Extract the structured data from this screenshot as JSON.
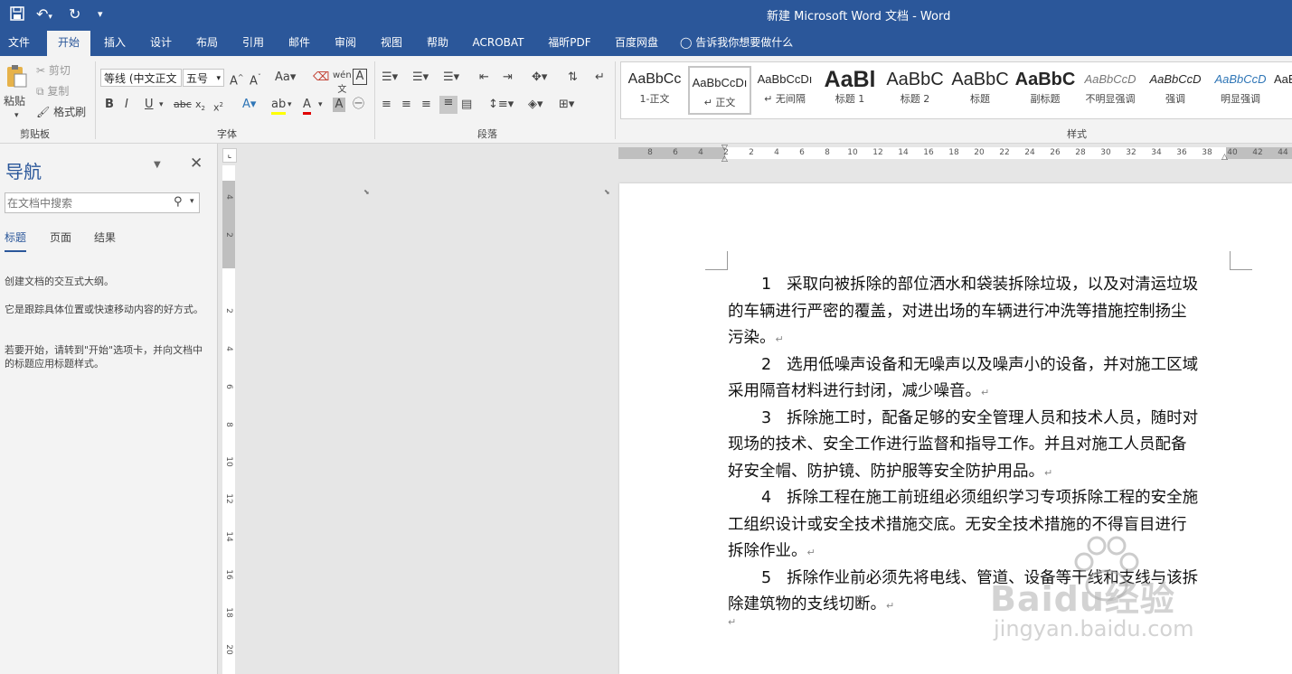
{
  "window": {
    "title": "新建 Microsoft Word 文档  -  Word"
  },
  "qat": {
    "save_icon": "save-icon",
    "undo_icon": "undo-icon",
    "redo_icon": "redo-icon",
    "customize_icon": "customize-icon"
  },
  "tabs": [
    "文件",
    "开始",
    "插入",
    "设计",
    "布局",
    "引用",
    "邮件",
    "审阅",
    "视图",
    "帮助",
    "ACROBAT",
    "福昕PDF",
    "百度网盘"
  ],
  "active_tab": "开始",
  "tell_me": "告诉我你想要做什么",
  "clipboard": {
    "paste": "粘贴",
    "cut": "剪切",
    "copy": "复制",
    "format_painter": "格式刷",
    "label": "剪贴板"
  },
  "font": {
    "name": "等线 (中文正文",
    "size": "五号",
    "label": "字体"
  },
  "paragraph": {
    "label": "段落"
  },
  "styles": {
    "label": "样式",
    "items": [
      {
        "preview": "AaBbCc",
        "name": "1-正文"
      },
      {
        "preview": "AaBbCcDı",
        "name": "↵ 正文"
      },
      {
        "preview": "AaBbCcDı",
        "name": "↵ 无间隔"
      },
      {
        "preview": "AaBl",
        "name": "标题 1"
      },
      {
        "preview": "AaBbC",
        "name": "标题 2"
      },
      {
        "preview": "AaBbC",
        "name": "标题"
      },
      {
        "preview": "AaBbC",
        "name": "副标题"
      },
      {
        "preview": "AaBbCcD",
        "name": "不明显强调"
      },
      {
        "preview": "AaBbCcD",
        "name": "强调"
      },
      {
        "preview": "AaBbCcD",
        "name": "明显强调"
      },
      {
        "preview": "AaB",
        "name": ""
      }
    ]
  },
  "nav": {
    "title": "导航",
    "search_placeholder": "在文档中搜索",
    "tabs": [
      "标题",
      "页面",
      "结果"
    ],
    "texts": [
      "创建文档的交互式大纲。",
      "它是跟踪具体位置或快速移动内容的好方式。",
      "若要开始，请转到\"开始\"选项卡，并向文档中的标题应用标题样式。"
    ]
  },
  "hruler": [
    "8",
    "6",
    "4",
    "2",
    "2",
    "4",
    "6",
    "8",
    "10",
    "12",
    "14",
    "16",
    "18",
    "20",
    "22",
    "24",
    "26",
    "28",
    "30",
    "32",
    "34",
    "36",
    "38",
    "40",
    "42",
    "44"
  ],
  "vruler": [
    "4",
    "2",
    "2",
    "4",
    "6",
    "8",
    "10",
    "12",
    "14",
    "16",
    "18",
    "20"
  ],
  "document": {
    "paragraphs": [
      {
        "num": "1",
        "lines": [
          "采取向被拆除的部位洒水和袋装拆除垃圾，以及对清运垃圾",
          "的车辆进行严密的覆盖，对进出场的车辆进行冲洗等措施控制扬尘",
          "污染。"
        ]
      },
      {
        "num": "2",
        "lines": [
          "选用低噪声设备和无噪声以及噪声小的设备，并对施工区域",
          "采用隔音材料进行封闭，减少噪音。"
        ]
      },
      {
        "num": "3",
        "lines": [
          "拆除施工时，配备足够的安全管理人员和技术人员，随时对",
          "现场的技术、安全工作进行监督和指导工作。并且对施工人员配备",
          "好安全帽、防护镜、防护服等安全防护用品。"
        ]
      },
      {
        "num": "4",
        "lines": [
          "拆除工程在施工前班组必须组织学习专项拆除工程的安全施",
          "工组织设计或安全技术措施交底。无安全技术措施的不得盲目进行",
          "拆除作业。"
        ]
      },
      {
        "num": "5",
        "lines": [
          "拆除作业前必须先将电线、管道、设备等干线和支线与该拆",
          "除建筑物的支线切断。"
        ]
      }
    ],
    "para_mark": "↵"
  },
  "watermark": {
    "brand": "Baidu经验",
    "url": "jingyan.baidu.com"
  }
}
